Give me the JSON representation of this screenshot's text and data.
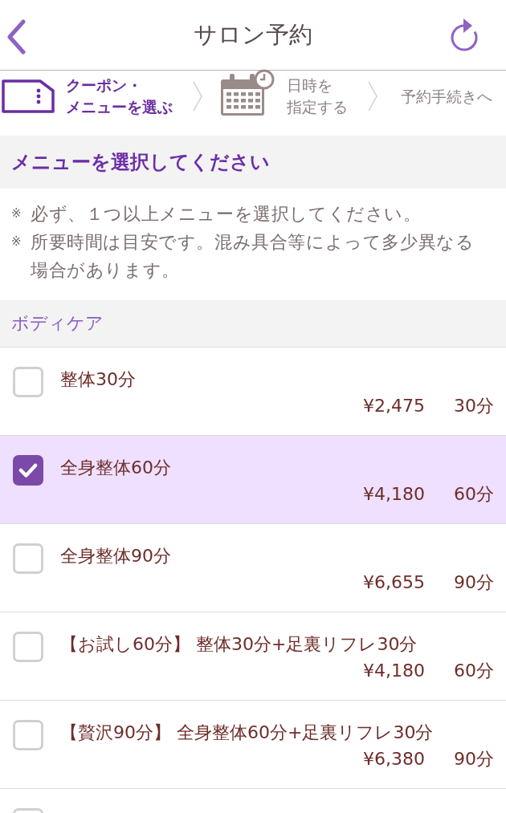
{
  "header": {
    "title": "サロン予約"
  },
  "steps": [
    {
      "kind": "coupon",
      "label_lines": [
        "クーポン・",
        "メニューを選ぶ"
      ],
      "selected": true
    },
    {
      "kind": "datetime",
      "label_lines": [
        "日時を",
        "指定する"
      ],
      "selected": false
    },
    {
      "kind": "text",
      "label_lines": [
        "予約手続きへ"
      ],
      "selected": false
    }
  ],
  "section": {
    "title": "メニューを選択してください"
  },
  "notes": [
    {
      "mark": "※",
      "text": "必ず、１つ以上メニューを選択してください。"
    },
    {
      "mark": "※",
      "text": "所要時間は目安です。混み具合等によって多少異なる場合があります。"
    }
  ],
  "category": {
    "title": "ボディケア"
  },
  "items": [
    {
      "title": "整体30分",
      "price": "¥2,475",
      "duration": "30分",
      "checked": false
    },
    {
      "title": "全身整体60分",
      "price": "¥4,180",
      "duration": "60分",
      "checked": true
    },
    {
      "title": "全身整体90分",
      "price": "¥6,655",
      "duration": "90分",
      "checked": false
    },
    {
      "title": "【お試し60分】 整体30分+足裏リフレ30分",
      "price": "¥4,180",
      "duration": "60分",
      "checked": false
    },
    {
      "title": "【贅沢90分】 全身整体60分+足裏リフレ30分",
      "price": "¥6,380",
      "duration": "90分",
      "checked": false
    },
    {
      "checked": false
    }
  ]
}
